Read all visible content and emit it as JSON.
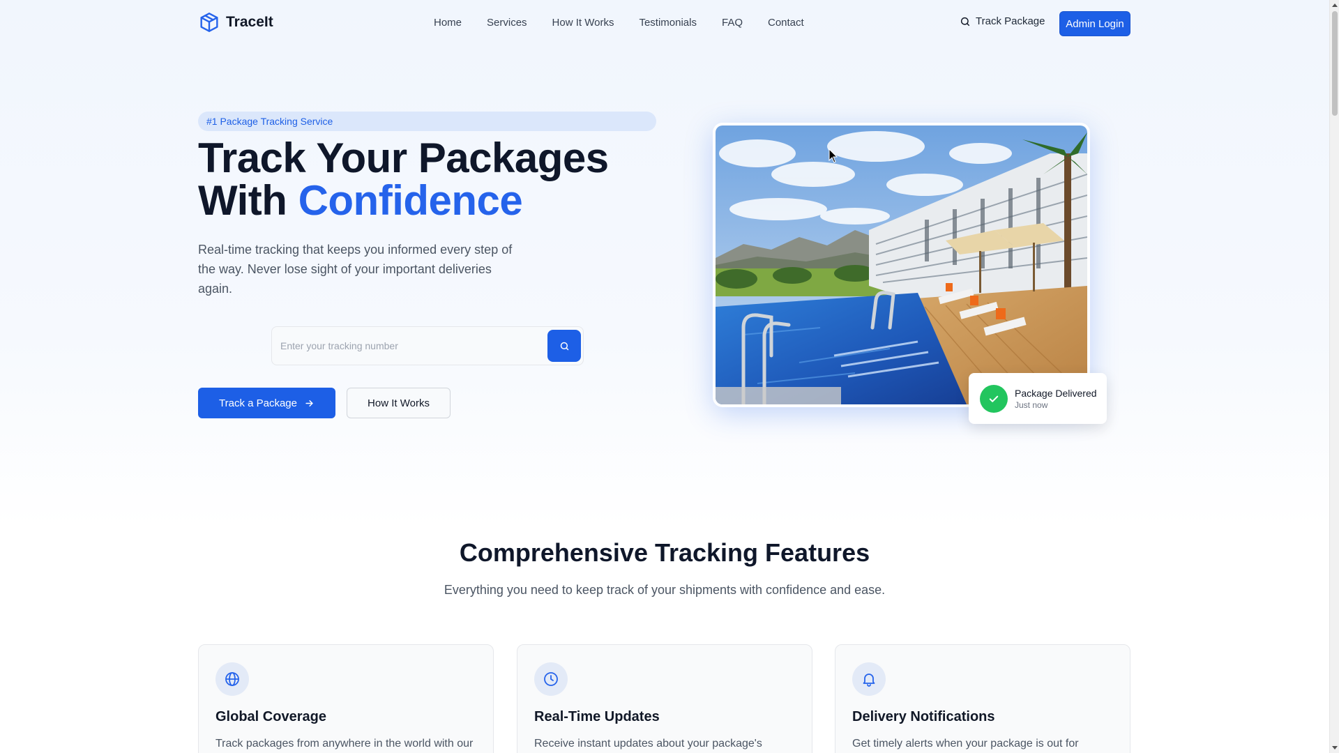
{
  "brand": {
    "name": "TraceIt",
    "logo_icon": "package-cube-icon"
  },
  "nav": {
    "links": [
      "Home",
      "Services",
      "How It Works",
      "Testimonials",
      "FAQ",
      "Contact"
    ],
    "track_label": "Track Package",
    "admin_label": "Admin Login"
  },
  "hero": {
    "badge": "#1 Package Tracking Service",
    "title_line1": "Track Your Packages",
    "title_line2_prefix": "With ",
    "title_accent": "Confidence",
    "subtitle": "Real-time tracking that keeps you informed every step of the way. Never lose sight of your important deliveries again.",
    "search_placeholder": "Enter your tracking number",
    "search_value": "",
    "primary_cta": "Track a Package",
    "secondary_cta": "How It Works",
    "toast_title": "Package Delivered",
    "toast_time": "Just now"
  },
  "features": {
    "title": "Comprehensive Tracking Features",
    "subtitle": "Everything you need to keep track of your shipments with confidence and ease.",
    "cards": [
      {
        "icon": "globe-icon",
        "title": "Global Coverage",
        "desc": "Track packages from anywhere in the world with our"
      },
      {
        "icon": "clock-icon",
        "title": "Real-Time Updates",
        "desc": "Receive instant updates about your package's"
      },
      {
        "icon": "bell-icon",
        "title": "Delivery Notifications",
        "desc": "Get timely alerts when your package is out for"
      }
    ]
  },
  "colors": {
    "accent": "#1d5fe6",
    "success": "#22c55e",
    "heading": "#0f172a"
  }
}
